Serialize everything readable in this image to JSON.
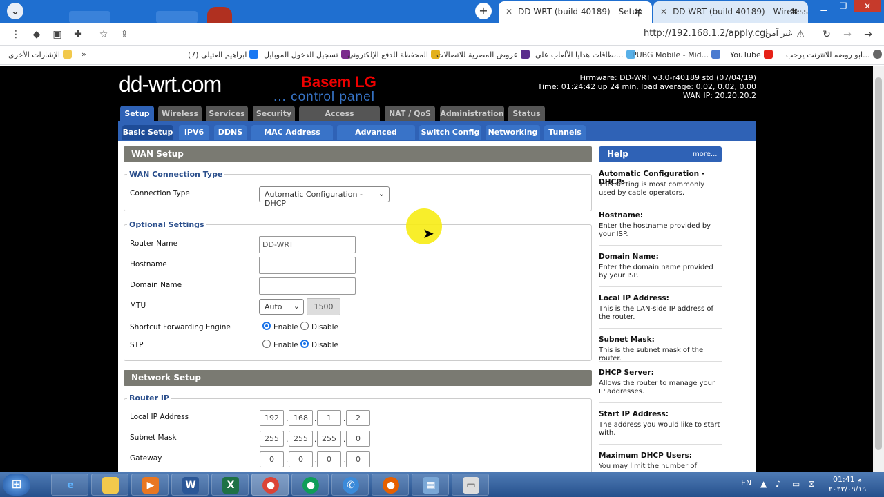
{
  "browser": {
    "tabs": [
      {
        "title": "DD-WRT (build 40189) - Setup",
        "close": "✕",
        "favicon": "router-favicon"
      },
      {
        "title": "DD-WRT (build 40189) - Wireless",
        "close": "✕",
        "favicon": "router-favicon"
      }
    ],
    "url": "http://192.168.1.2/apply.cgi",
    "security_label": "غير آمن",
    "bookmarks": [
      {
        "label": "ابو روضه للانترنت يرحب...",
        "icon": "globe-icon",
        "color": "#666666"
      },
      {
        "label": "YouTube",
        "icon": "youtube-icon",
        "color": "#e62117"
      },
      {
        "label": "PUBG Mobile - Mid...",
        "icon": "pubg-icon",
        "color": "#4a7bd0"
      },
      {
        "label": "بطاقات هدايا الألعاب علي...",
        "icon": "card-icon",
        "color": "#58b0e8"
      },
      {
        "label": "عروض المصرية للاتصالات",
        "icon": "we-icon",
        "color": "#5a2d8c"
      },
      {
        "label": "المحفظة للدفع الإلكتروني",
        "icon": "wallet-icon",
        "color": "#e3b01b"
      },
      {
        "label": "تسجيل الدخول الموبايل",
        "icon": "mobile-icon",
        "color": "#7a2a8c"
      },
      {
        "label": "(7) ابراهيم العتيلي",
        "icon": "facebook-icon",
        "color": "#1877f2"
      }
    ],
    "other_bookmarks": "الإشارات الأخرى",
    "more": "»"
  },
  "router": {
    "logo": "dd-wrt.com",
    "brand": "Basem LG",
    "subtitle": "... control panel",
    "firmware": "Firmware: DD-WRT v3.0-r40189 std (07/04/19)",
    "time": "Time: 01:24:42 up 24 min, load average: 0.02, 0.02, 0.00",
    "wan_ip": "WAN IP: 20.20.20.2",
    "main_tabs": [
      "Setup",
      "Wireless",
      "Services",
      "Security",
      "Access Restrictions",
      "NAT / QoS",
      "Administration",
      "Status"
    ],
    "sub_tabs": [
      "Basic Setup",
      "IPV6",
      "DDNS",
      "MAC Address Clone",
      "Advanced Routing",
      "Switch Config",
      "Networking",
      "Tunnels"
    ]
  },
  "wan": {
    "section": "WAN Setup",
    "conn_legend": "WAN Connection Type",
    "conn_label": "Connection Type",
    "conn_value": "Automatic Configuration - DHCP",
    "opt_legend": "Optional Settings",
    "router_name_label": "Router Name",
    "router_name_value": "DD-WRT",
    "hostname_label": "Hostname",
    "domain_label": "Domain Name",
    "mtu_label": "MTU",
    "mtu_mode": "Auto",
    "mtu_value": "1500",
    "sfe_label": "Shortcut Forwarding Engine",
    "stp_label": "STP",
    "enable": "Enable",
    "disable": "Disable"
  },
  "network": {
    "section": "Network Setup",
    "legend": "Router IP",
    "local_ip_label": "Local IP Address",
    "local_ip": [
      "192",
      "168",
      "1",
      "2"
    ],
    "subnet_label": "Subnet Mask",
    "subnet": [
      "255",
      "255",
      "255",
      "0"
    ],
    "gateway_label": "Gateway",
    "gateway": [
      "0",
      "0",
      "0",
      "0"
    ]
  },
  "help": {
    "title": "Help",
    "more": "more...",
    "items": [
      {
        "title": "Automatic Configuration - DHCP:",
        "body": "This setting is most commonly used by cable operators."
      },
      {
        "title": "Hostname:",
        "body": "Enter the hostname provided by your ISP."
      },
      {
        "title": "Domain Name:",
        "body": "Enter the domain name provided by your ISP."
      },
      {
        "title": "Local IP Address:",
        "body": "This is the LAN-side IP address of the router."
      },
      {
        "title": "Subnet Mask:",
        "body": "This is the subnet mask of the router."
      },
      {
        "title": "DHCP Server:",
        "body": "Allows the router to manage your IP addresses."
      },
      {
        "title": "Start IP Address:",
        "body": "The address you would like to start with."
      },
      {
        "title": "Maximum DHCP Users:",
        "body": "You may limit the number of"
      }
    ]
  },
  "taskbar": {
    "lang": "EN",
    "time": "01:41 م",
    "date": "٢٠٢٣/٠٩/١٩",
    "apps": [
      "ie-icon",
      "explorer-icon",
      "media-player-icon",
      "word-icon",
      "excel-icon",
      "chrome-icon",
      "chrome-alt-icon",
      "phone-icon",
      "firefox-icon",
      "network-icon",
      "window-icon"
    ]
  }
}
